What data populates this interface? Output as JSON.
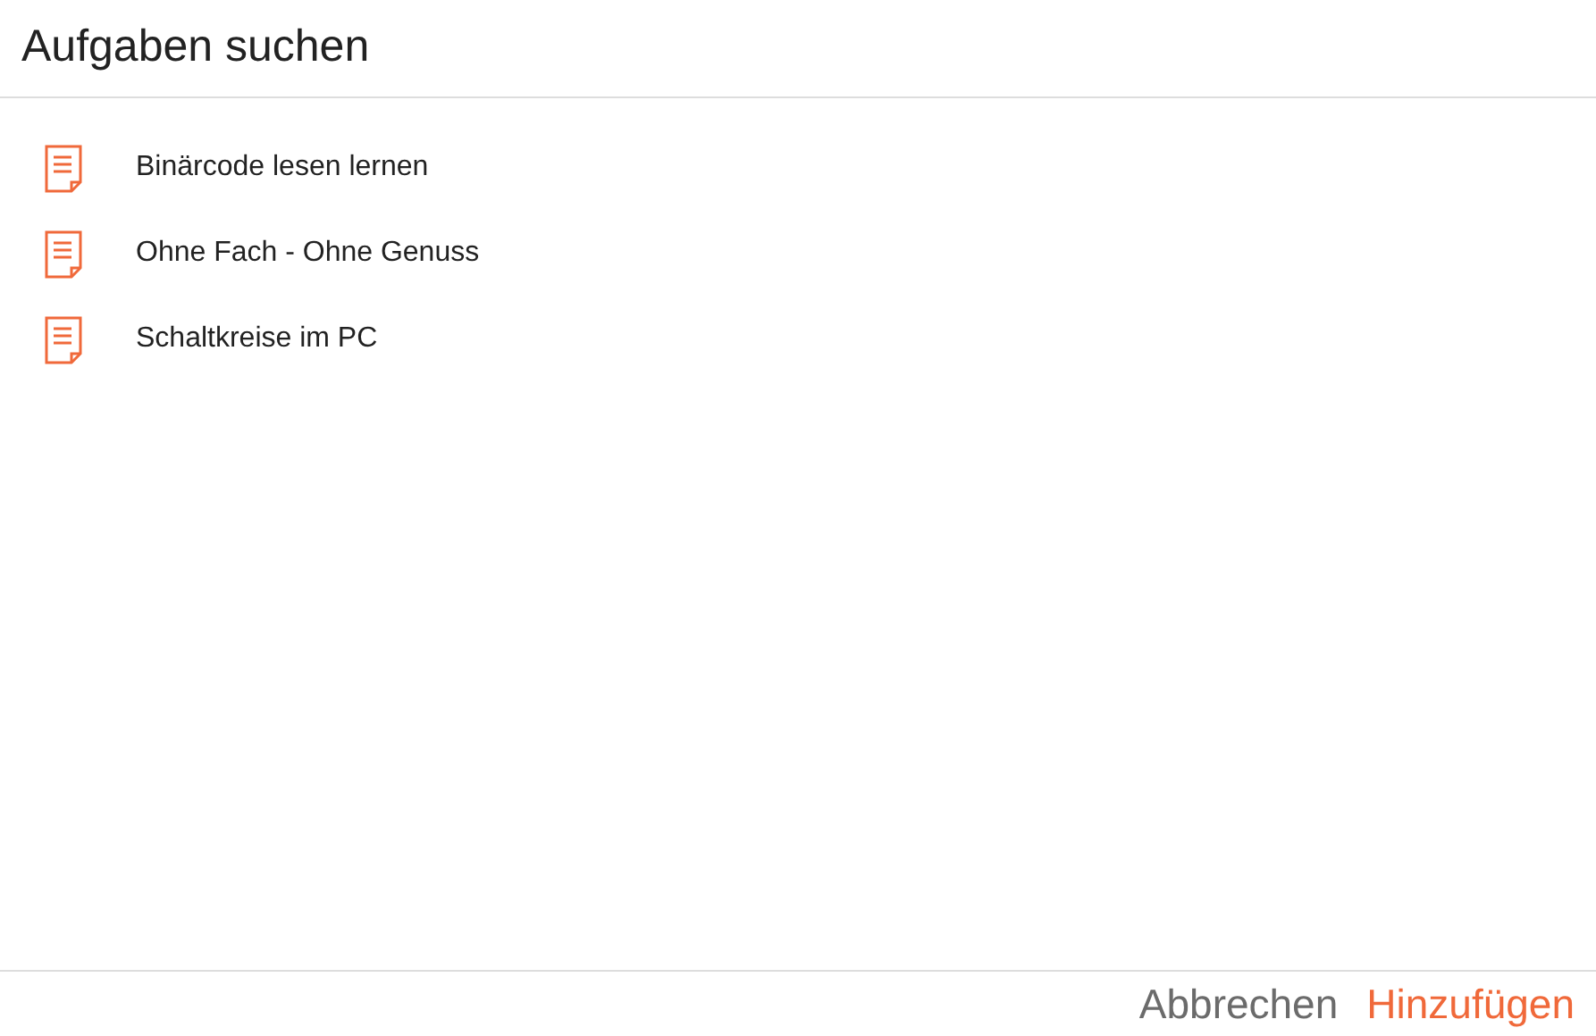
{
  "dialog": {
    "title": "Aufgaben suchen"
  },
  "items": [
    {
      "label": "Binärcode lesen lernen"
    },
    {
      "label": "Ohne Fach - Ohne Genuss"
    },
    {
      "label": "Schaltkreise im PC"
    }
  ],
  "buttons": [
    {
      "label": "Abbrechen",
      "kind": "secondary"
    },
    {
      "label": "Hinzufügen",
      "kind": "primary"
    }
  ]
}
